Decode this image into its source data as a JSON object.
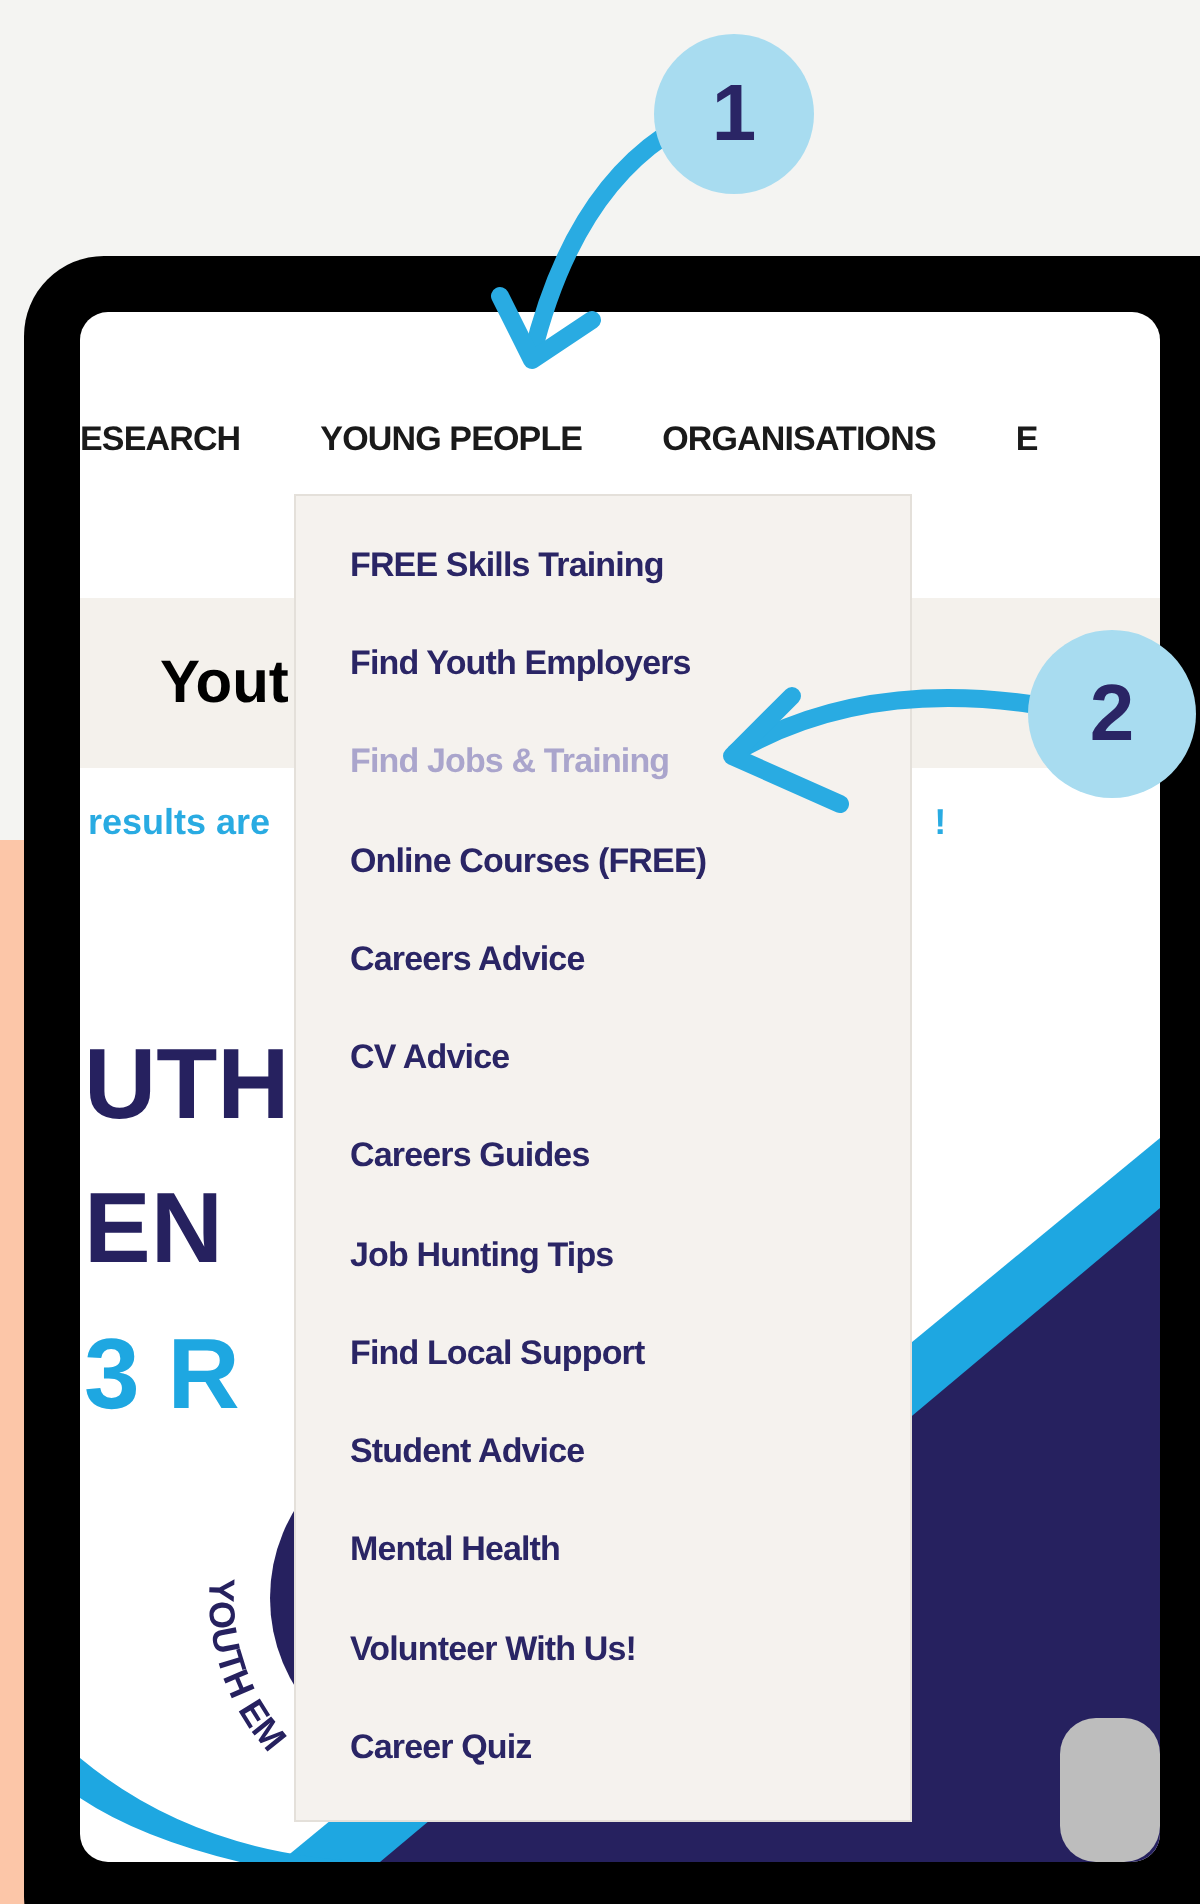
{
  "nav": {
    "items": [
      "ESEARCH",
      "YOUNG PEOPLE",
      "ORGANISATIONS",
      "E"
    ]
  },
  "dropdown": {
    "items": [
      {
        "label": "FREE Skills Training",
        "selected": false
      },
      {
        "label": "Find Youth Employers",
        "selected": false
      },
      {
        "label": "Find Jobs & Training",
        "selected": true
      },
      {
        "label": "Online Courses (FREE)",
        "selected": false
      },
      {
        "label": "Careers Advice",
        "selected": false
      },
      {
        "label": "CV Advice",
        "selected": false
      },
      {
        "label": "Careers Guides",
        "selected": false
      },
      {
        "label": "Job Hunting Tips",
        "selected": false
      },
      {
        "label": "Find Local Support",
        "selected": false
      },
      {
        "label": "Student Advice",
        "selected": false
      },
      {
        "label": "Mental Health",
        "selected": false
      },
      {
        "label": "Volunteer With Us!",
        "selected": false
      },
      {
        "label": "Career Quiz",
        "selected": false
      }
    ]
  },
  "page_heading": "Yout",
  "notice": {
    "start": "results are",
    "end": "!"
  },
  "banner": {
    "lines": [
      "UTH",
      "EN",
      "3 R"
    ],
    "logo_text": "YOUTH EM"
  },
  "callouts": [
    {
      "number": "1"
    },
    {
      "number": "2"
    }
  ]
}
